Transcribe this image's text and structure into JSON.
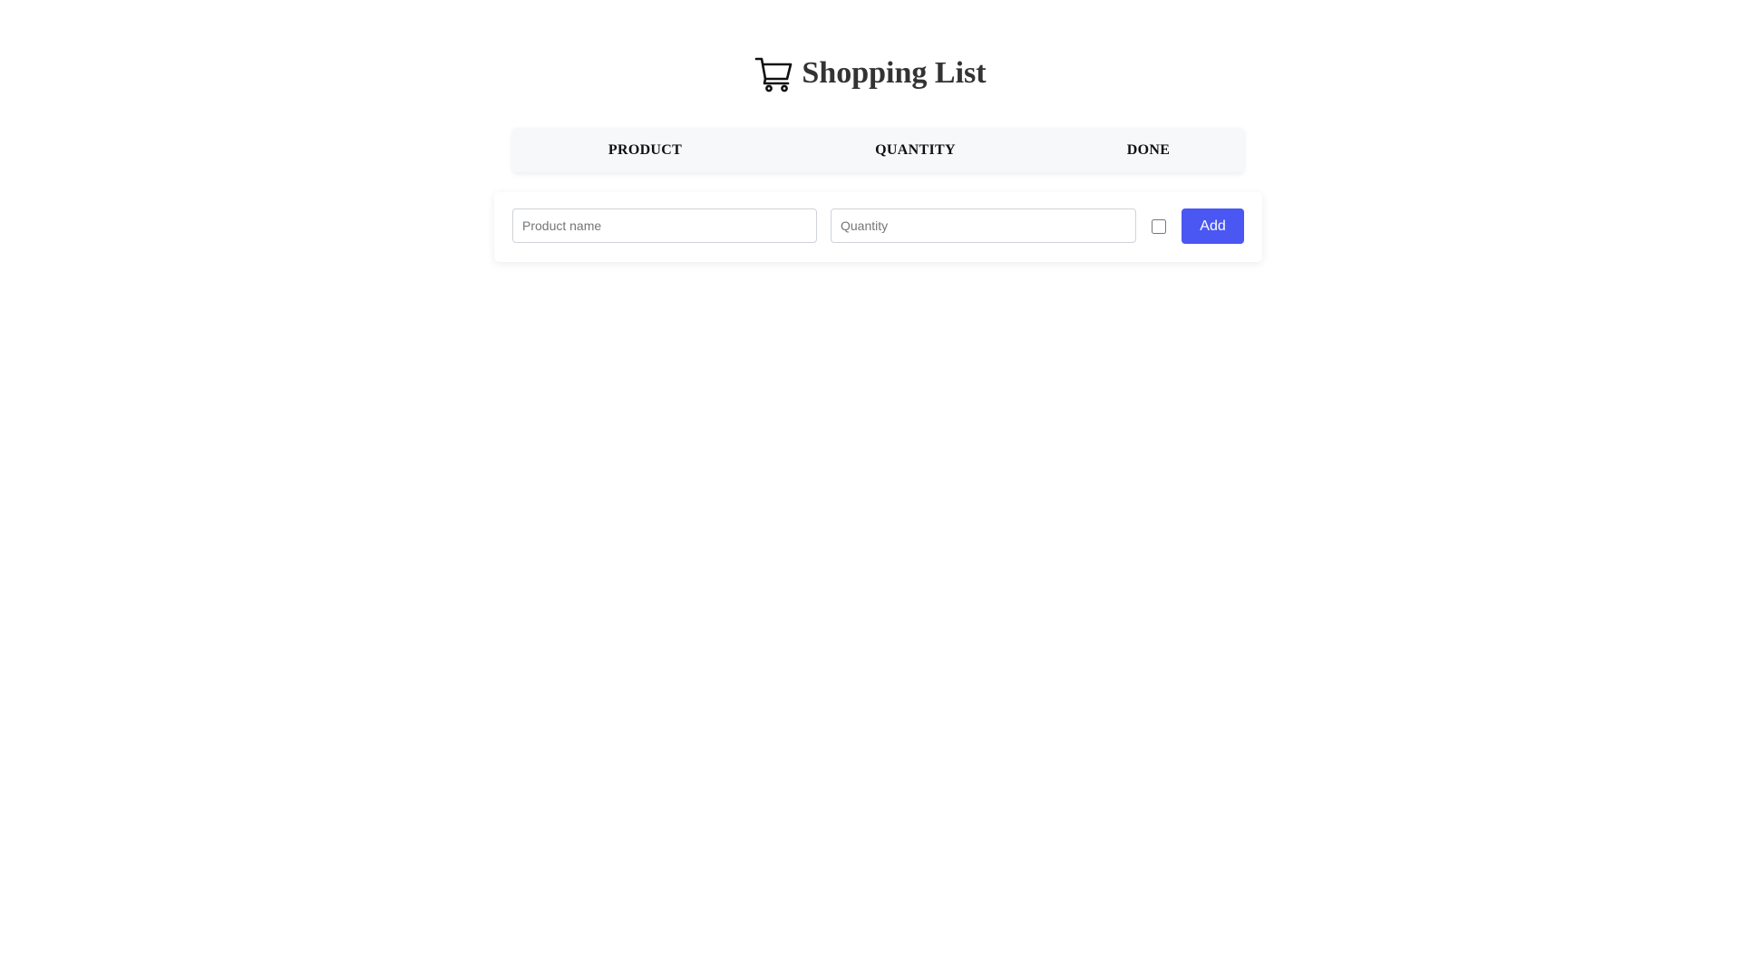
{
  "header": {
    "title": "Shopping List",
    "icon": "shopping-cart-icon"
  },
  "table": {
    "columns": [
      "PRODUCT",
      "QUANTITY",
      "DONE"
    ]
  },
  "form": {
    "product_placeholder": "Product name",
    "product_value": "",
    "quantity_placeholder": "Quantity",
    "quantity_value": "",
    "done_checked": false,
    "add_label": "Add"
  },
  "colors": {
    "accent": "#4a57f2",
    "title_text": "#333333",
    "header_bg": "#f7f8f9"
  }
}
